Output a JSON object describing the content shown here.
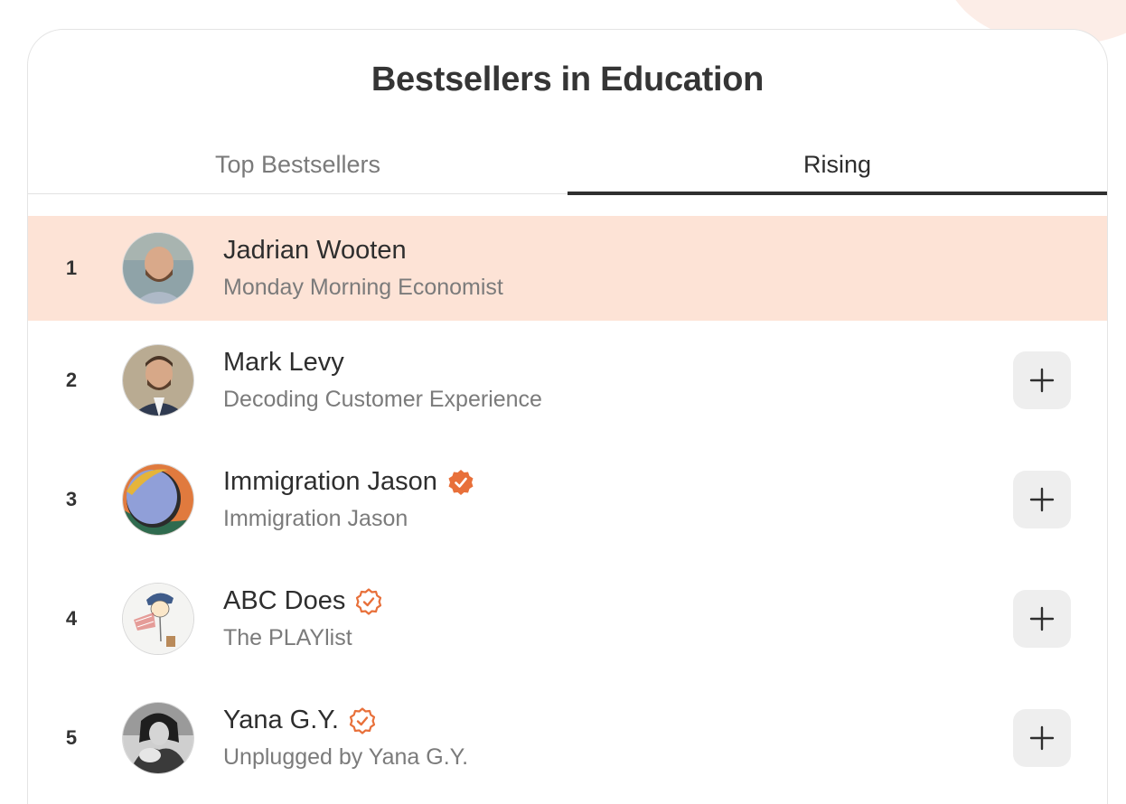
{
  "title": "Bestsellers in Education",
  "tabs": [
    {
      "label": "Top Bestsellers",
      "active": false
    },
    {
      "label": "Rising",
      "active": true
    }
  ],
  "colors": {
    "highlight": "#fde3d6",
    "accent": "#e8703a"
  },
  "items": [
    {
      "rank": "1",
      "name": "Jadrian Wooten",
      "publication": "Monday Morning Economist",
      "badge": "none",
      "avatar": "man-avatar"
    },
    {
      "rank": "2",
      "name": "Mark Levy",
      "publication": "Decoding Customer Experience",
      "badge": "none",
      "avatar": "man-avatar"
    },
    {
      "rank": "3",
      "name": "Immigration Jason",
      "publication": "Immigration Jason",
      "badge": "verified-filled-icon",
      "avatar": "abstract-art-avatar"
    },
    {
      "rank": "4",
      "name": "ABC Does",
      "publication": "The PLAYlist",
      "badge": "verified-outline-icon",
      "avatar": "cartoon-avatar"
    },
    {
      "rank": "5",
      "name": "Yana G.Y.",
      "publication": "Unplugged by Yana G.Y.",
      "badge": "verified-outline-icon",
      "avatar": "bw-photo-avatar"
    }
  ]
}
